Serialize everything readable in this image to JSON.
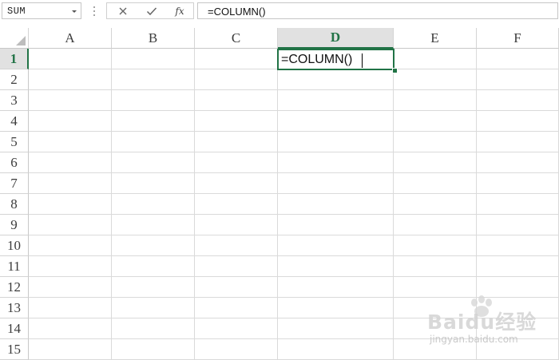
{
  "formula_bar": {
    "name_box": "SUM",
    "formula": "=COLUMN()",
    "buttons": {
      "cancel_icon": "close-icon",
      "enter_icon": "check-icon",
      "function_label": "fx"
    }
  },
  "columns": [
    "A",
    "B",
    "C",
    "D",
    "E",
    "F"
  ],
  "rows": [
    "1",
    "2",
    "3",
    "4",
    "5",
    "6",
    "7",
    "8",
    "9",
    "10",
    "11",
    "12",
    "13",
    "14",
    "15"
  ],
  "active_cell": {
    "column": "D",
    "row": "1",
    "content": "=COLUMN()"
  },
  "watermark": {
    "brand": "Bai⁠du经验",
    "site": "jingyan.baidu.com"
  },
  "colors": {
    "accent": "#217346",
    "header_active_bg": "#e1e1e1",
    "gridline": "#dadada"
  }
}
